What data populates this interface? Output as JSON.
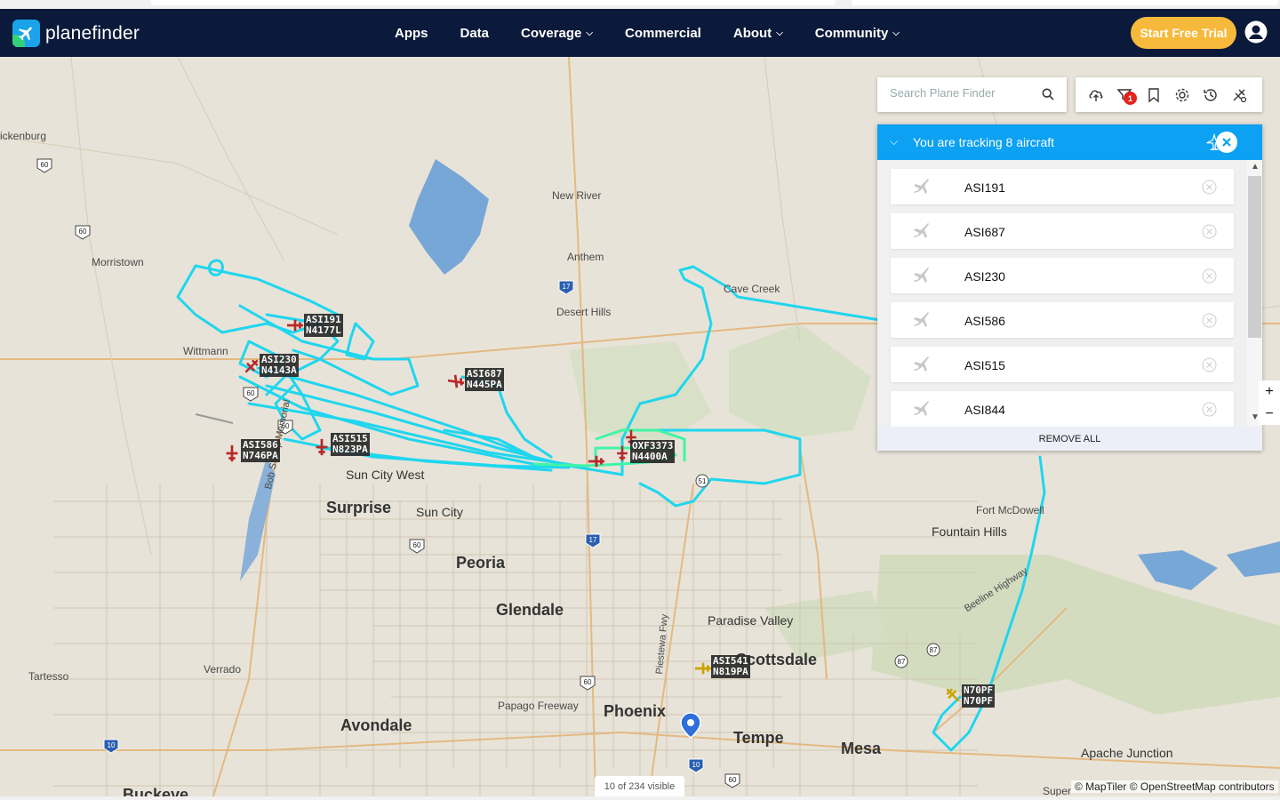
{
  "brand": {
    "name": "planefinder"
  },
  "nav": {
    "items": [
      {
        "label": "Apps",
        "has_menu": false
      },
      {
        "label": "Data",
        "has_menu": false
      },
      {
        "label": "Coverage",
        "has_menu": true
      },
      {
        "label": "Commercial",
        "has_menu": false
      },
      {
        "label": "About",
        "has_menu": true
      },
      {
        "label": "Community",
        "has_menu": true
      }
    ],
    "trial_label": "Start Free Trial"
  },
  "search": {
    "placeholder": "Search Plane Finder",
    "value": ""
  },
  "toolbar": {
    "icons": [
      "cloud-upload-icon",
      "filter-icon",
      "bookmark-icon",
      "settings-icon",
      "history-icon",
      "plane-settings-icon"
    ],
    "filter_badge": "1"
  },
  "tracking": {
    "title": "You are tracking 8 aircraft",
    "items": [
      "ASI191",
      "ASI687",
      "ASI230",
      "ASI586",
      "ASI515",
      "ASI844"
    ],
    "remove_all": "REMOVE ALL"
  },
  "map": {
    "places": [
      {
        "name": "ickenburg",
        "size": "small"
      },
      {
        "name": "Morristown",
        "size": "small"
      },
      {
        "name": "Wittmann",
        "size": "small"
      },
      {
        "name": "New River",
        "size": "small"
      },
      {
        "name": "Anthem",
        "size": "small"
      },
      {
        "name": "Desert Hills",
        "size": "small"
      },
      {
        "name": "Cave Creek",
        "size": "small"
      },
      {
        "name": "Sun City West",
        "size": "mid"
      },
      {
        "name": "Surprise",
        "size": "big"
      },
      {
        "name": "Sun City",
        "size": "mid"
      },
      {
        "name": "Peoria",
        "size": "big"
      },
      {
        "name": "Glendale",
        "size": "big"
      },
      {
        "name": "Fort McDowell",
        "size": "small"
      },
      {
        "name": "Fountain Hills",
        "size": "mid"
      },
      {
        "name": "Paradise Valley",
        "size": "mid"
      },
      {
        "name": "Scottsdale",
        "size": "big"
      },
      {
        "name": "Tartesso",
        "size": "small"
      },
      {
        "name": "Verrado",
        "size": "small"
      },
      {
        "name": "Papago Freeway",
        "size": "small"
      },
      {
        "name": "Phoenix",
        "size": "big"
      },
      {
        "name": "Avondale",
        "size": "big"
      },
      {
        "name": "Tempe",
        "size": "big"
      },
      {
        "name": "Mesa",
        "size": "big"
      },
      {
        "name": "Apache Junction",
        "size": "mid"
      },
      {
        "name": "Bob Stump Memorial",
        "size": "small"
      },
      {
        "name": "Piestewa Fwy",
        "size": "small"
      },
      {
        "name": "Beeline Highway",
        "size": "small"
      },
      {
        "name": "Super",
        "size": "small"
      },
      {
        "name": "Buckeye",
        "size": "big"
      }
    ],
    "highway_shields": [
      "60",
      "60",
      "60",
      "60",
      "60",
      "60",
      "17",
      "17",
      "51",
      "87",
      "87",
      "10",
      "10",
      "60"
    ],
    "aircraft": [
      {
        "callsign": "ASI191",
        "reg": "N4177L"
      },
      {
        "callsign": "ASI230",
        "reg": "N4143A"
      },
      {
        "callsign": "ASI687",
        "reg": "N445PA"
      },
      {
        "callsign": "ASI586",
        "reg": "N746PA"
      },
      {
        "callsign": "ASI515",
        "reg": "N823PA"
      },
      {
        "callsign": "OXF3373",
        "reg": "N4400A"
      },
      {
        "callsign": "ASI541",
        "reg": "N819PA"
      },
      {
        "callsign": "N70PF",
        "reg": "N70PF"
      }
    ],
    "visible_count": "10 of 234 visible",
    "attribution": "© MapTiler © OpenStreetMap contributors",
    "zoom_in": "+",
    "zoom_out": "−"
  }
}
